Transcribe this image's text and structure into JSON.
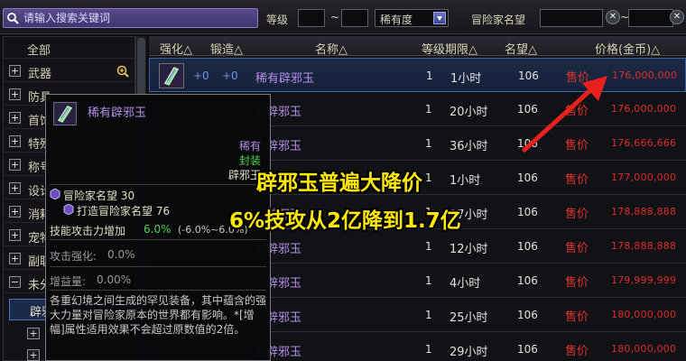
{
  "search": {
    "placeholder": "请输入搜索关键词"
  },
  "filters": {
    "level_label": "等级",
    "range_sep": "~",
    "rarity_value": "稀有度",
    "fame_label": "冒险家名望",
    "fame_sep": "~",
    "clear_symbol": "✕"
  },
  "sidebar": {
    "all": "全部",
    "items": [
      {
        "sign": "+",
        "label": "武器"
      },
      {
        "sign": "+",
        "label": "防具"
      },
      {
        "sign": "+",
        "label": "首饰"
      },
      {
        "sign": "+",
        "label": "特殊"
      },
      {
        "sign": "+",
        "label": "称号"
      },
      {
        "sign": "+",
        "label": "设计"
      },
      {
        "sign": "+",
        "label": "消耗"
      },
      {
        "sign": "+",
        "label": "宠物"
      },
      {
        "sign": "+",
        "label": "副职"
      },
      {
        "sign": "−",
        "label": "未分"
      }
    ],
    "selected": "辟邪",
    "sub_signs": [
      "+",
      "+"
    ]
  },
  "table": {
    "columns": {
      "enhance": "强化△",
      "forge": "锻造△",
      "name": "名称△",
      "level": "等级期限△",
      "fame": "名望△",
      "price": "价格(金币)△"
    },
    "rows": [
      {
        "enhance": "+0",
        "forge": "+0",
        "name": "稀有辟邪玉",
        "qty": "1",
        "time": "1小时",
        "fame": "106",
        "sell": "售价",
        "price": "176,000,000"
      },
      {
        "enhance": "",
        "forge": "",
        "name": "有辟邪玉",
        "qty": "1",
        "time": "20小时",
        "fame": "106",
        "sell": "售价",
        "price": "176,000,000"
      },
      {
        "enhance": "",
        "forge": "",
        "name": "有辟邪玉",
        "qty": "1",
        "time": "36小时",
        "fame": "106",
        "sell": "售价",
        "price": "176,666,666"
      },
      {
        "enhance": "",
        "forge": "",
        "name": "有辟邪玉",
        "qty": "1",
        "time": "1小时",
        "fame": "106",
        "sell": "售价",
        "price": "177,000,000"
      },
      {
        "enhance": "",
        "forge": "",
        "name": "有辟邪玉",
        "qty": "1",
        "time": "17小时",
        "fame": "106",
        "sell": "售价",
        "price": "178,888,888"
      },
      {
        "enhance": "",
        "forge": "",
        "name": "有辟邪玉",
        "qty": "1",
        "time": "12小时",
        "fame": "106",
        "sell": "售价",
        "price": "178,888,888"
      },
      {
        "enhance": "",
        "forge": "",
        "name": "有辟邪玉",
        "qty": "1",
        "time": "4小时",
        "fame": "106",
        "sell": "售价",
        "price": "179,999,999"
      },
      {
        "enhance": "",
        "forge": "",
        "name": "有辟邪玉",
        "qty": "1",
        "time": "25小时",
        "fame": "106",
        "sell": "售价",
        "price": "180,000,000"
      },
      {
        "enhance": "",
        "forge": "",
        "name": "有辟邪玉",
        "qty": "1",
        "time": "29小时",
        "fame": "106",
        "sell": "售价",
        "price": "180,000,000"
      }
    ]
  },
  "tooltip": {
    "title": "稀有辟邪玉",
    "rarity": "稀有",
    "sealed": "封装",
    "type": "辟邪玉",
    "fame_line": "冒险家名望 30",
    "forge_line": "打造冒险家名望 76",
    "skill_label": "技能攻击力增加",
    "skill_value": "6.0%",
    "skill_range": "(-6.0%~6.0%)",
    "attack_label": "攻击强化:",
    "attack_value": "0.0%",
    "gain_label": "增益量:",
    "gain_value": "0.00%",
    "description": "各重幻境之间生成的罕见装备，其中蕴含的强大力量对冒险家原本的世界都有影响。*[增幅]属性适用效果不会超过原数值的2倍。"
  },
  "annotation": {
    "line1": "辟邪玉普遍大降价",
    "line2": "6%技攻从2亿降到1.7亿",
    "color": "#ffe800"
  },
  "colors": {
    "price": "#dc2a2a",
    "item_name": "#b48ce8",
    "accent": "#3c5fa0"
  }
}
